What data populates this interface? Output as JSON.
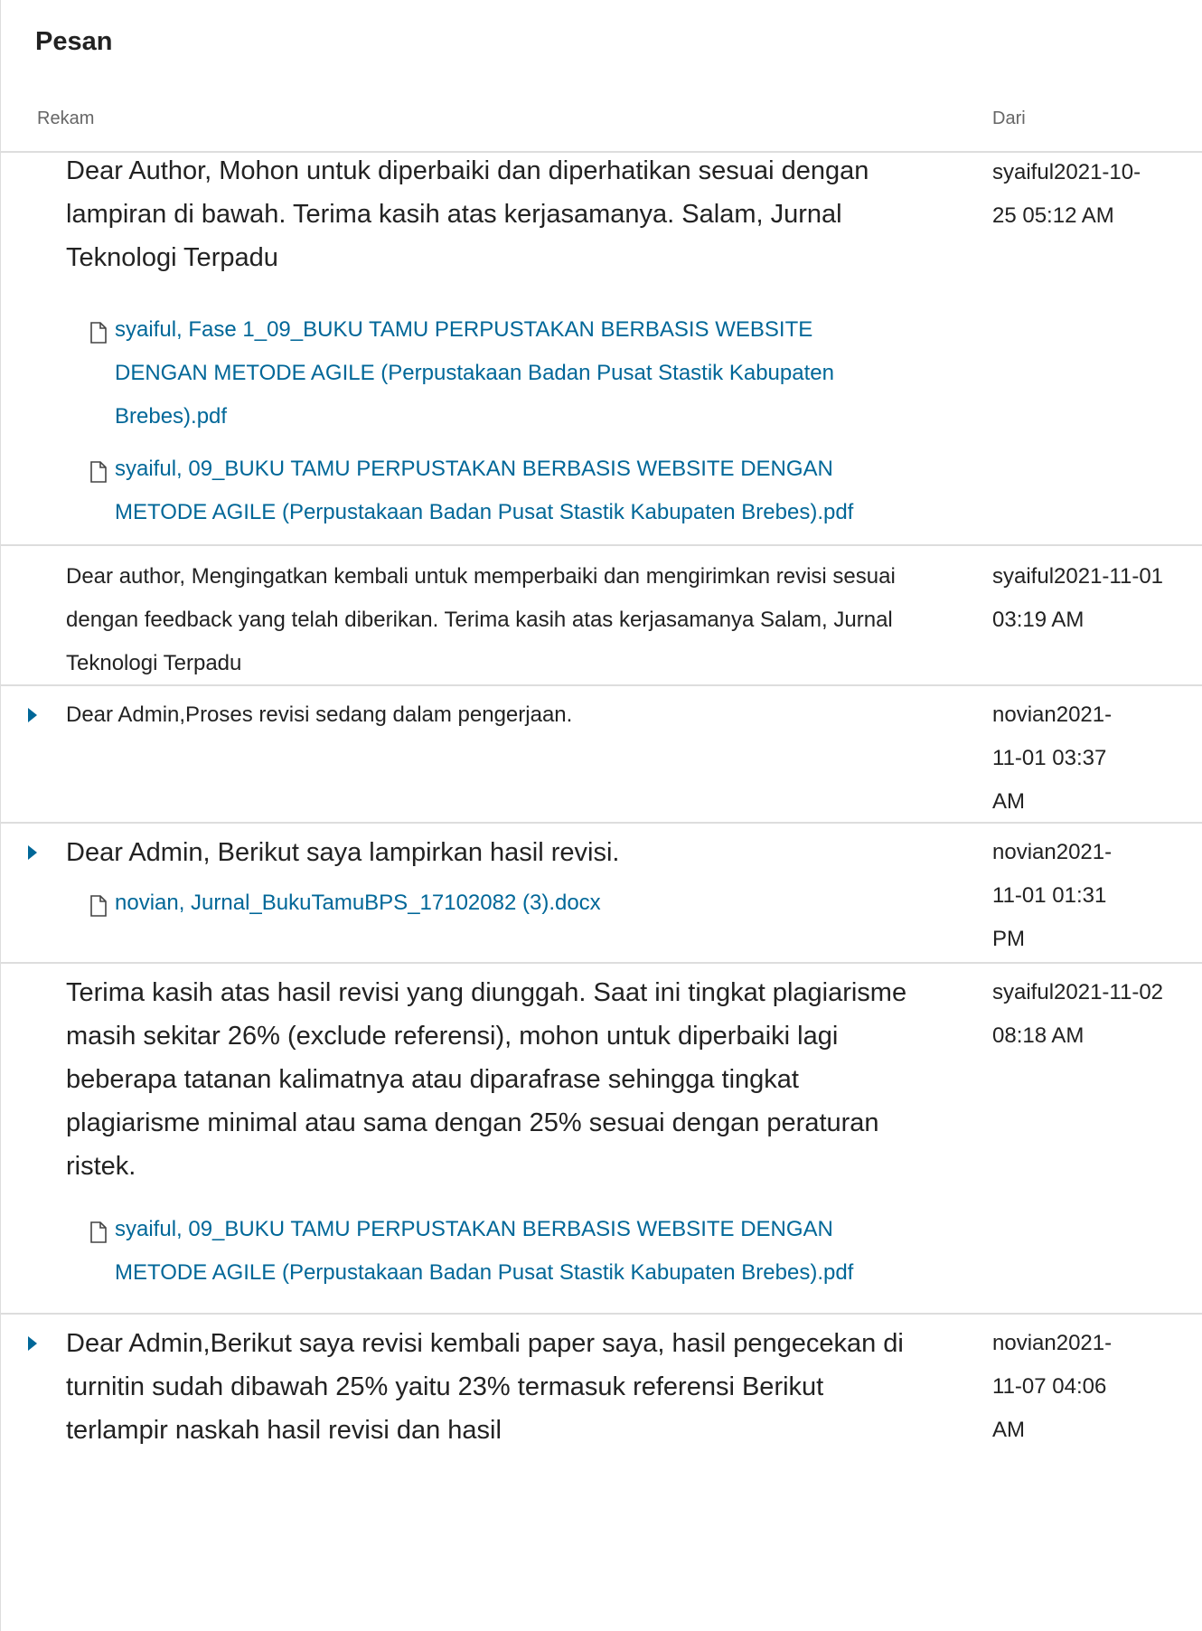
{
  "panel": {
    "title": "Pesan"
  },
  "columns": {
    "record": "Rekam",
    "from": "Dari"
  },
  "messages": [
    {
      "text": "Dear Author, Mohon untuk diperbaiki dan diperhatikan sesuai dengan lampiran di bawah. Terima kasih atas kerjasamanya. Salam, Jurnal Teknologi Terpadu",
      "from": "syaiful2021-10-25 05:12 AM",
      "files": [
        "syaiful, Fase 1_09_BUKU TAMU PERPUSTAKAN BERBASIS WEBSITE DENGAN METODE AGILE (Perpustakaan Badan Pusat Stastik Kabupaten Brebes).pdf",
        "syaiful, 09_BUKU TAMU PERPUSTAKAN BERBASIS WEBSITE DENGAN METODE AGILE (Perpustakaan Badan Pusat Stastik Kabupaten Brebes).pdf"
      ]
    },
    {
      "text": "Dear author, Mengingatkan kembali untuk memperbaiki dan mengirimkan revisi sesuai dengan feedback yang telah diberikan. Terima kasih atas kerjasamanya Salam, Jurnal Teknologi Terpadu",
      "from": "syaiful2021-11-01 03:19 AM",
      "files": []
    },
    {
      "text": "Dear Admin,Proses revisi sedang dalam pengerjaan.",
      "from": "novian2021-11-01 03:37 AM",
      "files": []
    },
    {
      "text": "Dear Admin, Berikut saya lampirkan hasil revisi.",
      "from": "novian2021-11-01 01:31 PM",
      "files": [
        "novian, Jurnal_BukuTamuBPS_17102082 (3).docx"
      ]
    },
    {
      "text": "Terima kasih atas hasil revisi yang diunggah. Saat ini tingkat plagiarisme masih sekitar 26% (exclude referensi), mohon untuk diperbaiki lagi beberapa tatanan kalimatnya atau diparafrase sehingga tingkat plagiarisme minimal atau sama dengan 25% sesuai dengan peraturan ristek.",
      "from": "syaiful2021-11-02 08:18 AM",
      "files": [
        "syaiful, 09_BUKU TAMU PERPUSTAKAN BERBASIS WEBSITE DENGAN METODE AGILE (Perpustakaan Badan Pusat Stastik Kabupaten Brebes).pdf"
      ]
    },
    {
      "text": "Dear Admin,Berikut saya revisi kembali paper saya, hasil pengecekan di turnitin sudah dibawah 25% yaitu 23% termasuk referensi Berikut terlampir naskah hasil revisi dan hasil",
      "from": "novian2021-11-07 04:06 AM",
      "files": []
    }
  ]
}
